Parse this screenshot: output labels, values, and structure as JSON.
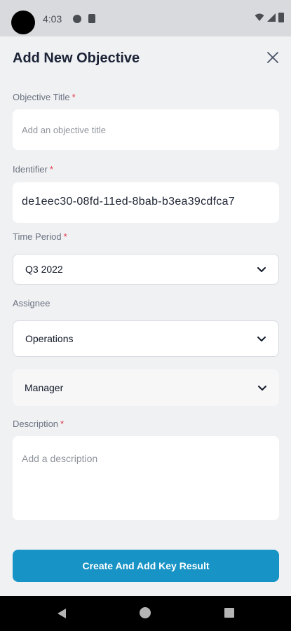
{
  "status_bar": {
    "time": "4:03"
  },
  "header": {
    "title": "Add New Objective"
  },
  "form": {
    "objective_title": {
      "label": "Objective Title",
      "required_mark": "*",
      "placeholder": "Add an objective title",
      "value": ""
    },
    "identifier": {
      "label": "Identifier",
      "required_mark": "*",
      "value": "de1eec30-08fd-11ed-8bab-b3ea39cdfca7"
    },
    "time_period": {
      "label": "Time Period",
      "required_mark": "*",
      "selected": "Q3 2022"
    },
    "assignee": {
      "label": "Assignee",
      "team_selected": "Operations",
      "role_selected": "Manager"
    },
    "description": {
      "label": "Description",
      "required_mark": "*",
      "placeholder": "Add a description"
    }
  },
  "actions": {
    "create_label": "Create And Add Key Result"
  },
  "colors": {
    "accent": "#1793c5",
    "required": "#e0394a"
  }
}
